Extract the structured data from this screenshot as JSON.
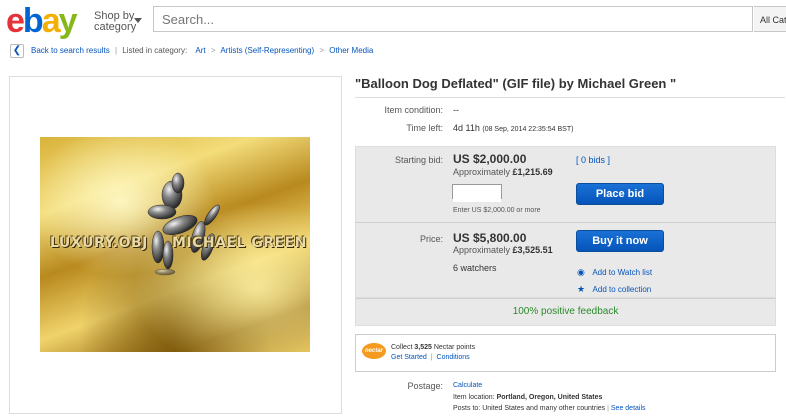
{
  "header": {
    "logo_letters": [
      "e",
      "b",
      "a",
      "y"
    ],
    "logo_colors": [
      "#e53238",
      "#0064d2",
      "#f5af02",
      "#86b817"
    ],
    "shop_by_line1": "Shop by",
    "shop_by_line2": "category",
    "search_placeholder": "Search...",
    "all_categories": "All Cat"
  },
  "breadcrumb": {
    "back_label": "Back to search results",
    "listed_in": "Listed in category:",
    "items": [
      "Art",
      "Artists (Self-Representing)",
      "Other Media"
    ]
  },
  "image": {
    "watermark_left": "LUXURY.OBJ",
    "watermark_right": "MICHAEL GREEN"
  },
  "listing": {
    "title": "\"Balloon Dog Deflated\" (GIF file) by Michael Green \"",
    "condition_label": "Item condition:",
    "condition_value": "--",
    "time_left_label": "Time left:",
    "time_left_value": "4d 11h",
    "time_left_detail": "(08 Sep, 2014  22:35:54 BST)"
  },
  "bid": {
    "starting_bid_label": "Starting bid:",
    "starting_bid_value": "US $2,000.00",
    "approx_prefix": "Approximately",
    "approx_value": "£1,215.69",
    "bids_link": "[ 0 bids ]",
    "place_bid_label": "Place bid",
    "enter_hint": "Enter US $2,000.00 or more"
  },
  "buy": {
    "price_label": "Price:",
    "price_value": "US $5,800.00",
    "approx_prefix": "Approximately",
    "approx_value": "£3,525.51",
    "buy_now_label": "Buy it now",
    "watchers": "6 watchers",
    "watch_list_label": "Add to Watch list",
    "collection_label": "Add to collection"
  },
  "feedback": "100% positive feedback",
  "nectar": {
    "logo_text": "nectar",
    "collect_prefix": "Collect",
    "points": "3,525",
    "collect_suffix": "Nectar points",
    "get_started": "Get Started",
    "conditions": "Conditions"
  },
  "postage": {
    "label": "Postage:",
    "calculate": "Calculate",
    "location_prefix": "Item location:",
    "location": "Portland, Oregon, United States",
    "posts_to_prefix": "Posts to:",
    "posts_to": "United States and many other countries",
    "see_details": "See details"
  }
}
